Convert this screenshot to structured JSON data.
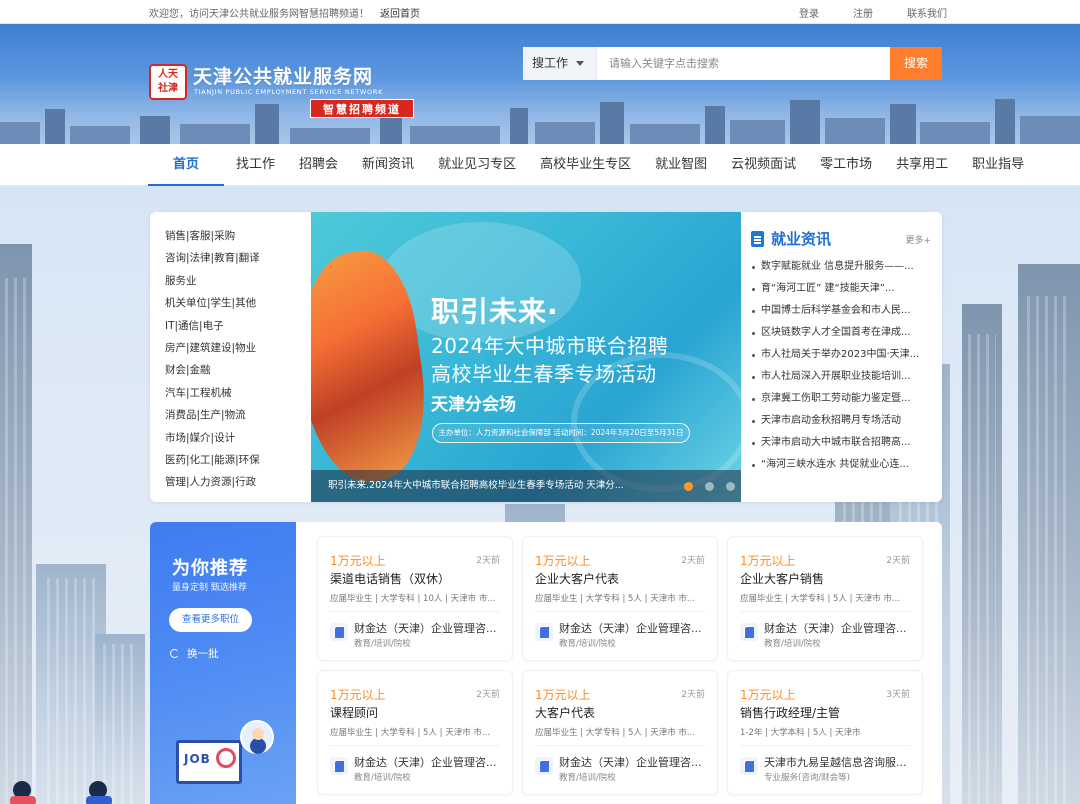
{
  "topbar": {
    "welcome": "欢迎您，访问天津公共就业服务网智慧招聘频道！",
    "home": "返回首页",
    "login": "登录",
    "register": "注册",
    "contact": "联系我们"
  },
  "logo": {
    "seal_line1": "人天",
    "seal_line2": "社津",
    "cn": "天津公共就业服务网",
    "en": "TIANJIN PUBLIC EMPLOYMENT SERVICE NETWORK",
    "tag": "智慧招聘频道"
  },
  "search": {
    "type": "搜工作",
    "placeholder": "请输入关键字点击搜索",
    "button": "搜索"
  },
  "nav": [
    "首页",
    "找工作",
    "招聘会",
    "新闻资讯",
    "就业见习专区",
    "高校毕业生专区",
    "就业智图",
    "云视频面试",
    "零工市场",
    "共享用工",
    "职业指导"
  ],
  "categories": [
    "销售|客服|采购",
    "咨询|法律|教育|翻译",
    "服务业",
    "机关单位|学生|其他",
    "IT|通信|电子",
    "房产|建筑建设|物业",
    "财会|金融",
    "汽车|工程机械",
    "消费品|生产|物流",
    "市场|媒介|设计",
    "医药|化工|能源|环保",
    "管理|人力资源|行政"
  ],
  "banner": {
    "line1": "职引未来·",
    "line2": "2024年大中城市联合招聘",
    "line3": "高校毕业生春季专场活动",
    "line4": "天津分会场",
    "org": "主办单位：人力资源和社会保障部    活动时间：2024年3月20日至5月31日",
    "caption": "职引未来.2024年大中城市联合招聘高校毕业生春季专场活动 天津分..."
  },
  "news": {
    "title": "就业资讯",
    "more": "更多+",
    "items": [
      "数字赋能就业 信息提升服务——...",
      "育“海河工匠” 建“技能天津”...",
      "中国博士后科学基金会和市人民...",
      "区块链数字人才全国首考在津成...",
      "市人社局关于举办2023中国·天津...",
      "市人社局深入开展职业技能培训...",
      "京津冀工伤职工劳动能力鉴定暨...",
      "天津市启动金秋招聘月专场活动",
      "天津市启动大中城市联合招聘高...",
      "“海河三峡水连水 共促就业心连..."
    ]
  },
  "recommend": {
    "title": "为你推荐",
    "subtitle": "量身定制 甄选推荐",
    "more_button": "查看更多职位",
    "refresh": "换一批",
    "illus_text": "JOB"
  },
  "jobs": [
    {
      "salary": "1万元以上",
      "time": "2天前",
      "title": "渠道电话销售（双休）",
      "tags": "应届毕业生 | 大学专科 | 10人 | 天津市 市...",
      "company": "财金达（天津）企业管理咨...",
      "industry": "教育/培训/院校"
    },
    {
      "salary": "1万元以上",
      "time": "2天前",
      "title": "企业大客户代表",
      "tags": "应届毕业生 | 大学专科 | 5人 | 天津市 市...",
      "company": "财金达（天津）企业管理咨...",
      "industry": "教育/培训/院校"
    },
    {
      "salary": "1万元以上",
      "time": "2天前",
      "title": "企业大客户销售",
      "tags": "应届毕业生 | 大学专科 | 5人 | 天津市 市...",
      "company": "财金达（天津）企业管理咨...",
      "industry": "教育/培训/院校"
    },
    {
      "salary": "1万元以上",
      "time": "2天前",
      "title": "课程顾问",
      "tags": "应届毕业生 | 大学专科 | 5人 | 天津市 市...",
      "company": "财金达（天津）企业管理咨...",
      "industry": "教育/培训/院校"
    },
    {
      "salary": "1万元以上",
      "time": "2天前",
      "title": "大客户代表",
      "tags": "应届毕业生 | 大学专科 | 5人 | 天津市 市...",
      "company": "财金达（天津）企业管理咨...",
      "industry": "教育/培训/院校"
    },
    {
      "salary": "1万元以上",
      "time": "3天前",
      "title": "销售行政经理/主管",
      "tags": "1-2年 | 大学本科 | 5人 | 天津市",
      "company": "天津市九易呈越信息咨询服...",
      "industry": "专业服务(咨询/财会等)"
    }
  ],
  "colors": {
    "primary": "#1f6fd0",
    "accent": "#ff7e2e",
    "salary": "#ff8a1f",
    "seal": "#d8281e"
  }
}
